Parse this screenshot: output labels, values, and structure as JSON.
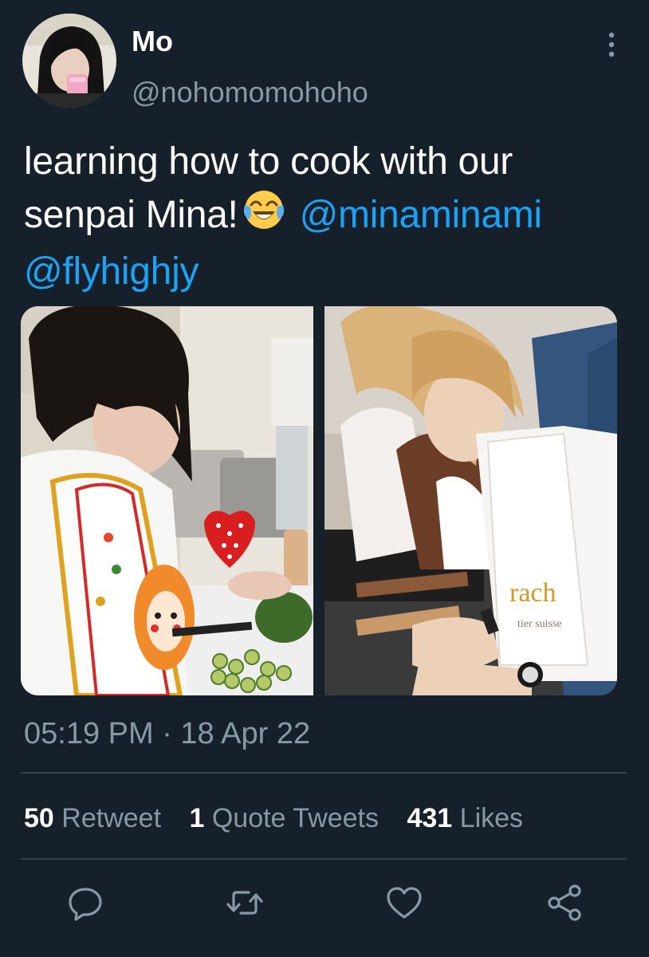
{
  "tweet": {
    "display_name": "Mo",
    "handle": "@nohomomohoho",
    "text": {
      "line1": "learning how to cook with our",
      "line2_start": "senpai Mina!",
      "emoji": "face-with-tears-of-joy",
      "mention1": "@minaminami",
      "mention2": "@flyhighjy"
    },
    "media": [
      {
        "name": "media-photo-left",
        "description_icon": "photo"
      },
      {
        "name": "media-photo-right",
        "description_icon": "photo"
      }
    ],
    "timestamp": "05:19 PM · 18 Apr 22",
    "stats": {
      "retweets": {
        "count": "50",
        "label": "Retweet"
      },
      "quotes": {
        "count": "1",
        "label": "Quote Tweets"
      },
      "likes": {
        "count": "431",
        "label": "Likes"
      }
    },
    "actions": [
      "reply-icon",
      "retweet-icon",
      "like-icon",
      "share-icon"
    ]
  },
  "colors": {
    "background": "#15202b",
    "text_primary": "#ffffff",
    "text_secondary": "#8899a6",
    "link": "#1da1f2",
    "divider": "#38444d"
  }
}
